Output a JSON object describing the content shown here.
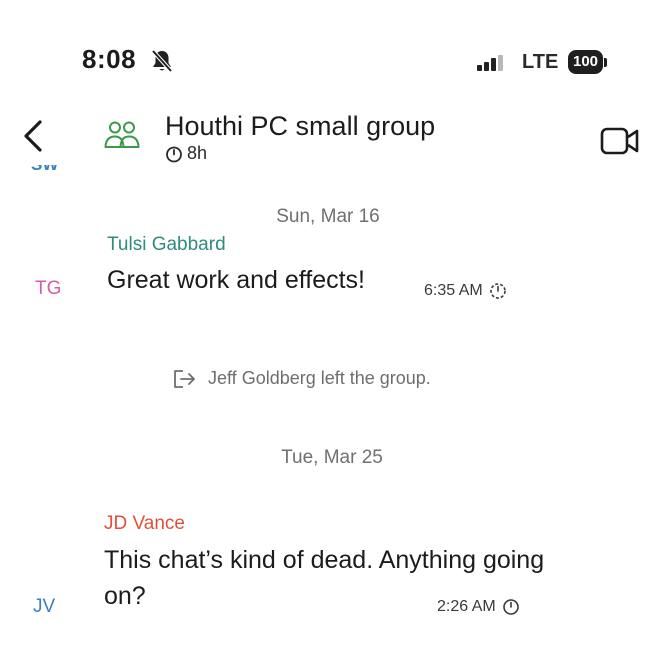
{
  "status_bar": {
    "time": "8:08",
    "network": "LTE",
    "battery": "100",
    "icons": [
      "bell-slash-icon",
      "signal-icon"
    ]
  },
  "header": {
    "title": "Houthi PC small group",
    "disappearing_timer": "8h",
    "icons": [
      "back-chevron-icon",
      "group-icon",
      "timer-icon",
      "video-call-icon"
    ]
  },
  "clipped_row": {
    "initials": "SW"
  },
  "conversation": {
    "dates": [
      "Sun, Mar 16",
      "Tue, Mar 25"
    ],
    "messages": [
      {
        "sender": "Tulsi Gabbard",
        "initials": "TG",
        "text": "Great work and effects!",
        "time": "6:35 AM",
        "sender_color": "#2e8b80",
        "initials_color": "#d35ea6"
      },
      {
        "sender": "JD Vance",
        "initials": "JV",
        "text": "This chat’s kind of dead. Anything going on?",
        "time": "2:26 AM",
        "sender_color": "#e2503a",
        "initials_color": "#3b7fc4"
      }
    ],
    "system_message": "Jeff Goldberg left the group."
  }
}
